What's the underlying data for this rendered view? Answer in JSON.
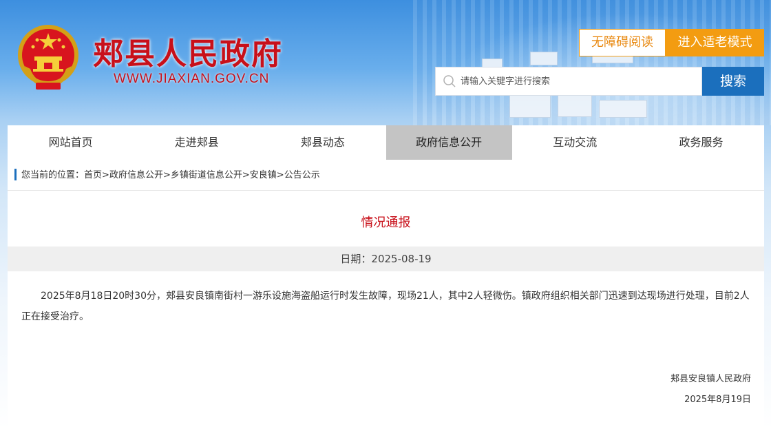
{
  "header": {
    "site_title": "郏县人民政府",
    "site_url": "WWW.JIAXIAN.GOV.CN",
    "accessible_label": "无障碍阅读",
    "elder_mode_label": "进入适老模式",
    "search": {
      "placeholder": "请输入关键字进行搜索",
      "button_label": "搜索"
    }
  },
  "nav": {
    "items": [
      {
        "label": "网站首页"
      },
      {
        "label": "走进郏县"
      },
      {
        "label": "郏县动态"
      },
      {
        "label": "政府信息公开"
      },
      {
        "label": "互动交流"
      },
      {
        "label": "政务服务"
      }
    ],
    "active": "政府信息公开"
  },
  "breadcrumb": {
    "prefix": "您当前的位置：",
    "items": [
      "首页",
      "政府信息公开",
      "乡镇街道信息公开",
      "安良镇",
      "公告公示"
    ],
    "separator": ">"
  },
  "article": {
    "title": "情况通报",
    "date_label": "日期：2025-08-19",
    "body": "2025年8月18日20时30分，郏县安良镇南街村一游乐设施海盗船运行时发生故障，现场21人，其中2人轻微伤。镇政府组织相关部门迅速到达现场进行处理，目前2人正在接受治疗。",
    "signature_org": "郏县安良镇人民政府",
    "signature_date": "2025年8月19日"
  },
  "colors": {
    "brand_red": "#c8101a",
    "accent_orange": "#f39c11",
    "search_blue": "#1b6fbd",
    "nav_active_bg": "#c4c4c4"
  },
  "icons": {
    "emblem": "national-emblem-icon",
    "search": "search-icon"
  }
}
